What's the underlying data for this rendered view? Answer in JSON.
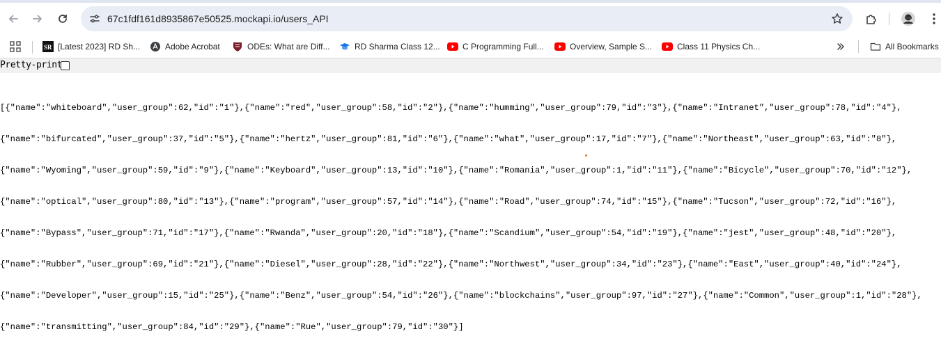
{
  "browser": {
    "url": "67c1fdf161d8935867e50525.mockapi.io/users_API",
    "icons": [
      "back-arrow-icon",
      "forward-arrow-icon",
      "reload-icon",
      "site-info-icon",
      "star-icon",
      "extensions-icon",
      "profile-avatar-icon",
      "more-menu-icon"
    ],
    "colors": {
      "omnibox": "#e9eef6",
      "youtube_red": "#ff0000"
    }
  },
  "bookmarks": {
    "items": [
      {
        "label": "[Latest 2023] RD Sh...",
        "icon": "sr-logo-icon"
      },
      {
        "label": "Adobe Acrobat",
        "icon": "acrobat-icon"
      },
      {
        "label": "ODEs: What are Diff...",
        "icon": "shield-crest-icon"
      },
      {
        "label": "RD Sharma Class 12...",
        "icon": "graduation-cap-icon"
      },
      {
        "label": "C Programming Full...",
        "icon": "youtube-icon"
      },
      {
        "label": "Overview, Sample S...",
        "icon": "youtube-icon"
      },
      {
        "label": "Class 11 Physics Ch...",
        "icon": "youtube-icon"
      }
    ],
    "overflow_icon": "chevron-double-right-icon",
    "all_bookmarks": "All Bookmarks"
  },
  "page": {
    "pretty_print_label": "Pretty-print",
    "pretty_print_checked": false,
    "json_lines": [
      "[{\"name\":\"whiteboard\",\"user_group\":62,\"id\":\"1\"},{\"name\":\"red\",\"user_group\":58,\"id\":\"2\"},{\"name\":\"humming\",\"user_group\":79,\"id\":\"3\"},{\"name\":\"Intranet\",\"user_group\":78,\"id\":\"4\"},",
      "{\"name\":\"bifurcated\",\"user_group\":37,\"id\":\"5\"},{\"name\":\"hertz\",\"user_group\":81,\"id\":\"6\"},{\"name\":\"what\",\"user_group\":17,\"id\":\"7\"},{\"name\":\"Northeast\",\"user_group\":63,\"id\":\"8\"},",
      "{\"name\":\"Wyoming\",\"user_group\":59,\"id\":\"9\"},{\"name\":\"Keyboard\",\"user_group\":13,\"id\":\"10\"},{\"name\":\"Romania\",\"user_group\":1,\"id\":\"11\"},{\"name\":\"Bicycle\",\"user_group\":70,\"id\":\"12\"},",
      "{\"name\":\"optical\",\"user_group\":80,\"id\":\"13\"},{\"name\":\"program\",\"user_group\":57,\"id\":\"14\"},{\"name\":\"Road\",\"user_group\":74,\"id\":\"15\"},{\"name\":\"Tucson\",\"user_group\":72,\"id\":\"16\"},",
      "{\"name\":\"Bypass\",\"user_group\":71,\"id\":\"17\"},{\"name\":\"Rwanda\",\"user_group\":20,\"id\":\"18\"},{\"name\":\"Scandium\",\"user_group\":54,\"id\":\"19\"},{\"name\":\"jest\",\"user_group\":48,\"id\":\"20\"},",
      "{\"name\":\"Rubber\",\"user_group\":69,\"id\":\"21\"},{\"name\":\"Diesel\",\"user_group\":28,\"id\":\"22\"},{\"name\":\"Northwest\",\"user_group\":34,\"id\":\"23\"},{\"name\":\"East\",\"user_group\":40,\"id\":\"24\"},",
      "{\"name\":\"Developer\",\"user_group\":15,\"id\":\"25\"},{\"name\":\"Benz\",\"user_group\":54,\"id\":\"26\"},{\"name\":\"blockchains\",\"user_group\":97,\"id\":\"27\"},{\"name\":\"Common\",\"user_group\":1,\"id\":\"28\"},",
      "{\"name\":\"transmitting\",\"user_group\":84,\"id\":\"29\"},{\"name\":\"Rue\",\"user_group\":79,\"id\":\"30\"}]"
    ]
  }
}
